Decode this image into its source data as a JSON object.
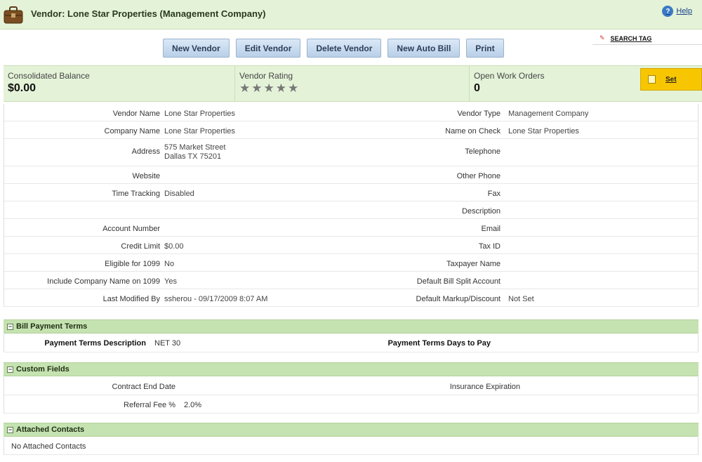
{
  "header": {
    "title": "Vendor: Lone Star Properties (Management Company)",
    "help_label": "Help",
    "help_icon": "question-icon"
  },
  "toolbar": {
    "buttons": [
      "New Vendor",
      "Edit Vendor",
      "Delete Vendor",
      "New Auto Bill",
      "Print"
    ]
  },
  "search_tag": {
    "label": "SEARCH TAG"
  },
  "summary": {
    "balance_label": "Consolidated Balance",
    "balance_value": "$0.00",
    "rating_label": "Vendor Rating",
    "rating_stars": 0,
    "rating_max": 5,
    "work_orders_label": "Open Work Orders",
    "work_orders_value": "0",
    "set_label": "Set"
  },
  "details": {
    "left": [
      {
        "label": "Vendor Name",
        "value": "Lone Star Properties"
      },
      {
        "label": "Company Name",
        "value": "Lone Star Properties"
      },
      {
        "label": "Address",
        "value": "575 Market Street",
        "value2": "Dallas TX 75201"
      },
      {
        "label": "Website",
        "value": ""
      },
      {
        "label": "Time Tracking",
        "value": "Disabled"
      },
      {
        "label": "",
        "value": ""
      },
      {
        "label": "Account Number",
        "value": ""
      },
      {
        "label": "Credit Limit",
        "value": "$0.00"
      },
      {
        "label": "Eligible for 1099",
        "value": "No"
      },
      {
        "label": "Include Company Name on 1099",
        "value": "Yes"
      },
      {
        "label": "Last Modified By",
        "value": "ssherou - 09/17/2009 8:07 AM"
      }
    ],
    "right": [
      {
        "label": "Vendor Type",
        "value": "Management Company"
      },
      {
        "label": "Name on Check",
        "value": "Lone Star Properties"
      },
      {
        "label": "Telephone",
        "value": ""
      },
      {
        "label": "Other Phone",
        "value": ""
      },
      {
        "label": "Fax",
        "value": ""
      },
      {
        "label": "Description",
        "value": ""
      },
      {
        "label": "Email",
        "value": ""
      },
      {
        "label": "Tax ID",
        "value": ""
      },
      {
        "label": "Taxpayer Name",
        "value": ""
      },
      {
        "label": "Default Bill Split Account",
        "value": ""
      },
      {
        "label": "Default Markup/Discount",
        "value": "Not Set"
      }
    ]
  },
  "bill_payment": {
    "title": "Bill Payment Terms",
    "desc_label": "Payment Terms Description",
    "desc_value": "NET 30",
    "days_label": "Payment Terms Days to Pay",
    "days_value": ""
  },
  "custom_fields": {
    "title": "Custom Fields",
    "contract_label": "Contract End Date",
    "contract_value": "",
    "insurance_label": "Insurance Expiration",
    "insurance_value": "",
    "referral_label": "Referral Fee %",
    "referral_value": "2.0%"
  },
  "contacts": {
    "title": "Attached Contacts",
    "empty_text": "No Attached Contacts"
  },
  "colors": {
    "header_bg": "#e4f3d8",
    "section_bg": "#c5e2b1",
    "set_button_bg": "#f7c600",
    "button_bg": "#c9dbef"
  }
}
